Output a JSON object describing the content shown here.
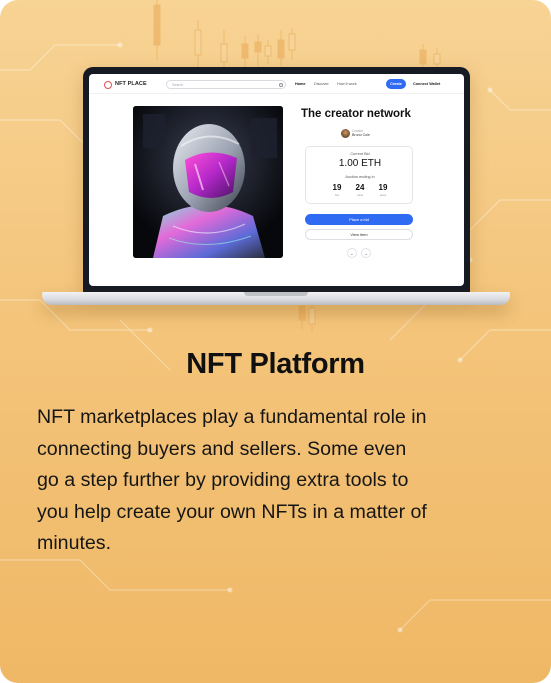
{
  "colors": {
    "card_bg": "#f4c57c",
    "accent_blue": "#2f6bf2",
    "logo_red": "#e2524e",
    "heading_text": "#101010"
  },
  "app": {
    "logo_icon": "nft-place-logo-icon",
    "logo_text": "NFT PLACE",
    "search_placeholder": "Search",
    "nav_links": [
      "Home",
      "Discover",
      "How it work"
    ],
    "create_label": "Create",
    "connect_wallet_label": "Connect Wallet"
  },
  "nft": {
    "title": "The creator network",
    "creator_label": "Creator",
    "creator_name": "Bruno Cole",
    "current_bid_label": "Current Bid",
    "current_bid_value": "1.00 ETH",
    "auction_label": "Auction ending in",
    "countdown": [
      {
        "value": "19",
        "unit": "hrs"
      },
      {
        "value": "24",
        "unit": "mins"
      },
      {
        "value": "19",
        "unit": "secs"
      }
    ],
    "place_bid_label": "Place a bid",
    "view_item_label": "View item",
    "prev_icon": "arrow-left-icon",
    "prev_glyph": "←",
    "next_icon": "arrow-right-icon",
    "next_glyph": "→"
  },
  "content": {
    "heading": "NFT Platform",
    "body_lines": [
      "NFT marketplaces play a fundamental role in",
      "connecting buyers and sellers. Some even",
      "go a step further by providing extra tools to",
      "you help create your own NFTs in a matter of",
      "minutes."
    ]
  }
}
